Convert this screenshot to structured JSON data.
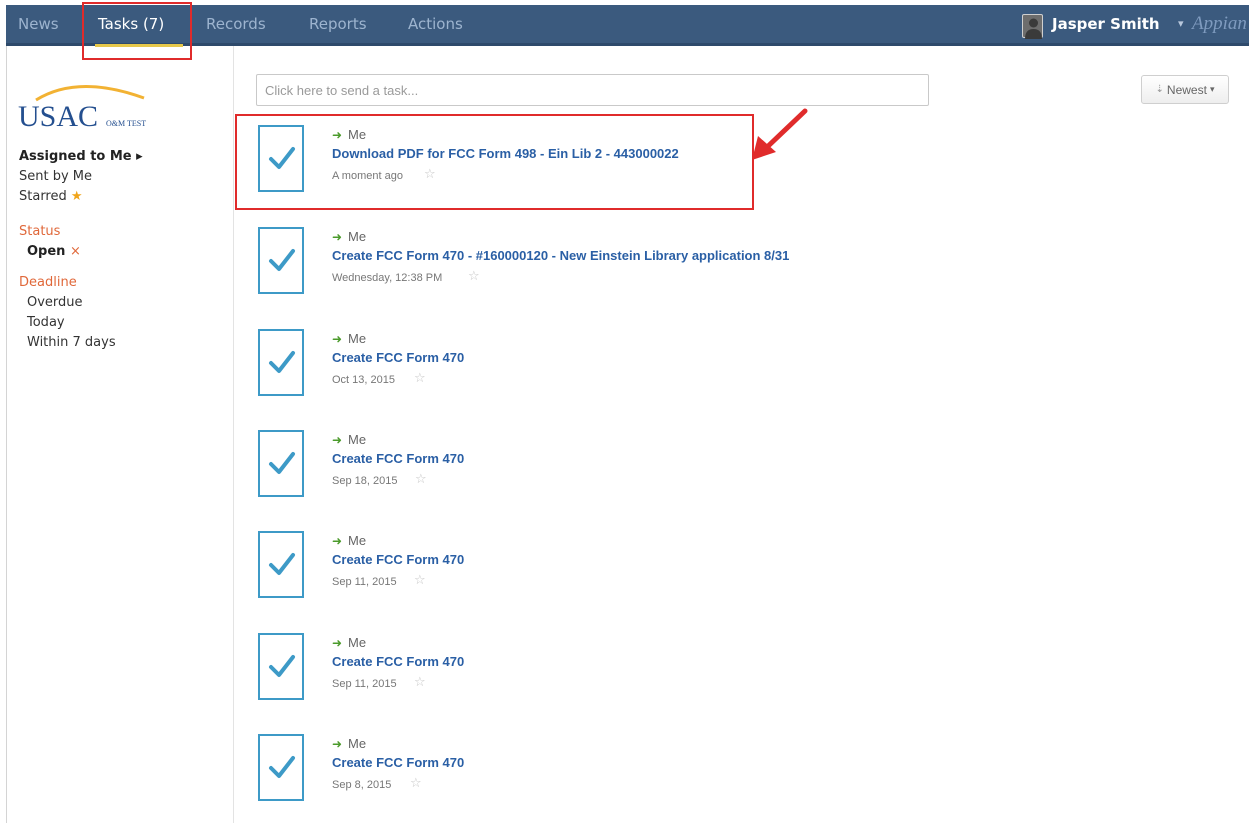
{
  "nav": {
    "tabs": [
      {
        "label": "News"
      },
      {
        "label": "Tasks (7)"
      },
      {
        "label": "Records"
      },
      {
        "label": "Reports"
      },
      {
        "label": "Actions"
      }
    ],
    "user_name": "Jasper Smith",
    "brand": "Appian"
  },
  "colors": {
    "nav_bg": "#3b5a7e",
    "accent_link": "#2a5fa5",
    "section_heading": "#e0683a",
    "task_icon": "#3d9ac7",
    "highlight": "#e02b2b"
  },
  "sidebar": {
    "logo_text": "USAC",
    "logo_sub": "O&M TEST",
    "filters": [
      {
        "label": "Assigned to Me ▸"
      },
      {
        "label": "Sent by Me"
      },
      {
        "label": "Starred"
      }
    ],
    "status_heading": "Status",
    "status_value": "Open",
    "deadline_heading": "Deadline",
    "deadline_options": [
      {
        "label": "Overdue"
      },
      {
        "label": "Today"
      },
      {
        "label": "Within 7 days"
      }
    ]
  },
  "main": {
    "send_placeholder": "Click here to send a task...",
    "sort_label": "Newest",
    "tasks": [
      {
        "to": "Me",
        "title": "Download PDF for FCC Form 498 - Ein Lib 2 - 443000022",
        "time": "A moment ago"
      },
      {
        "to": "Me",
        "title": "Create FCC Form 470 - #160000120 - New Einstein Library application 8/31",
        "time": "Wednesday, 12:38 PM"
      },
      {
        "to": "Me",
        "title": "Create FCC Form 470",
        "time": "Oct 13, 2015"
      },
      {
        "to": "Me",
        "title": "Create FCC Form 470",
        "time": "Sep 18, 2015"
      },
      {
        "to": "Me",
        "title": "Create FCC Form 470",
        "time": "Sep 11, 2015"
      },
      {
        "to": "Me",
        "title": "Create FCC Form 470",
        "time": "Sep 11, 2015"
      },
      {
        "to": "Me",
        "title": "Create FCC Form 470",
        "time": "Sep 8, 2015"
      }
    ]
  }
}
